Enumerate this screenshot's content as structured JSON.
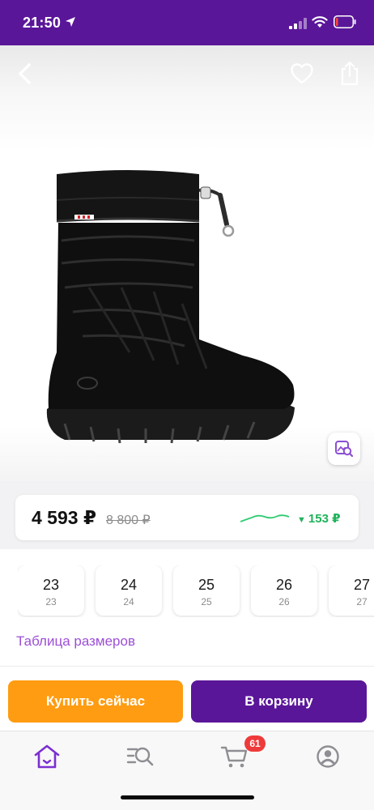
{
  "status_bar": {
    "time": "21:50",
    "icons": [
      "location-arrow-icon",
      "signal-icon",
      "wifi-icon",
      "battery-icon"
    ],
    "background": "#5a1699"
  },
  "top_actions": {
    "back_icon": "chevron-left-icon",
    "favorite_icon": "heart-icon",
    "share_icon": "share-icon"
  },
  "product": {
    "image": "black-rubber-boot",
    "visual_search_icon": "image-search-icon"
  },
  "price": {
    "current": "4 593 ₽",
    "old": "8 800 ₽",
    "drop": "153 ₽",
    "drop_arrow": "▼",
    "drop_color": "#1fb35a"
  },
  "sizes": [
    {
      "main": "23",
      "sub": "23"
    },
    {
      "main": "24",
      "sub": "24"
    },
    {
      "main": "25",
      "sub": "25"
    },
    {
      "main": "26",
      "sub": "26"
    },
    {
      "main": "27",
      "sub": "27"
    }
  ],
  "size_table_link": "Таблица размеров",
  "actions": {
    "buy_now": "Купить сейчас",
    "add_to_cart": "В корзину",
    "buy_color": "#ff9c11",
    "cart_color": "#5a1699"
  },
  "bottom_nav": {
    "items": [
      "home-icon",
      "catalog-search-icon",
      "cart-icon",
      "profile-icon"
    ],
    "cart_badge": "61",
    "active_color": "#7b2fd0"
  }
}
